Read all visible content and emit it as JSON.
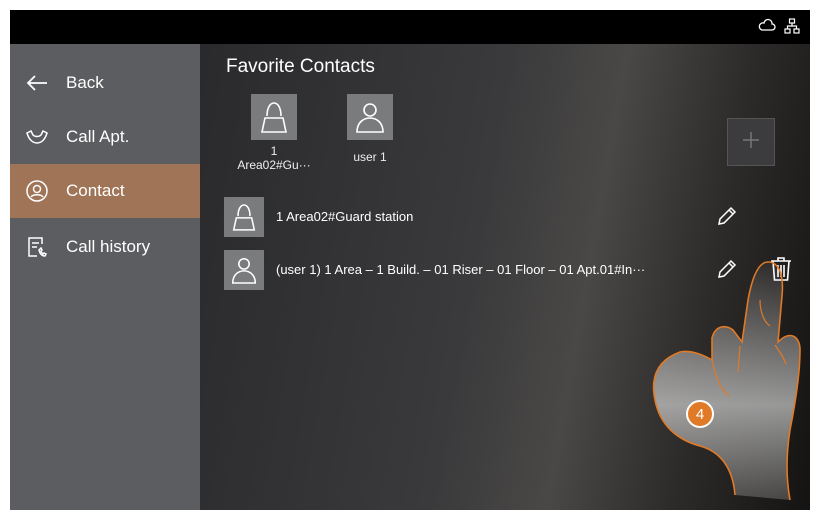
{
  "sidebar": {
    "items": [
      {
        "label": "Back",
        "icon": "arrow-left-icon"
      },
      {
        "label": "Call Apt.",
        "icon": "phone-handset-icon"
      },
      {
        "label": "Contact",
        "icon": "contact-icon",
        "active": true
      },
      {
        "label": "Call history",
        "icon": "call-history-icon"
      }
    ]
  },
  "main": {
    "title": "Favorite Contacts",
    "favorites": [
      {
        "line1": "1",
        "line2": "Area02#Gu···",
        "icon": "guard-icon"
      },
      {
        "line1": "user 1",
        "line2": "",
        "icon": "user-icon"
      }
    ],
    "contacts": [
      {
        "name": "1 Area02#Guard station",
        "icon": "guard-icon"
      },
      {
        "name": "(user 1) 1 Area – 1 Build. – 01 Riser – 01 Floor – 01 Apt.01#In···",
        "icon": "user-icon"
      }
    ]
  },
  "step_badge": "4",
  "colors": {
    "accent": "#a07456",
    "badge": "#e07a26",
    "hand_outline": "#e07a26"
  }
}
